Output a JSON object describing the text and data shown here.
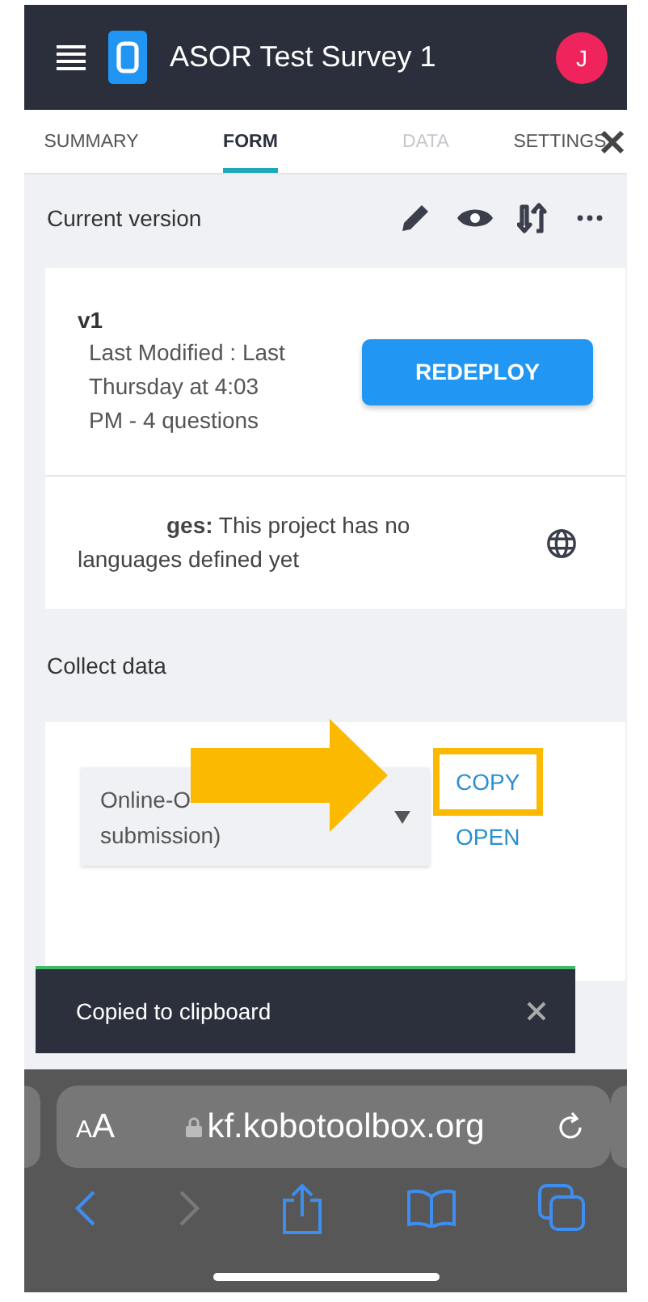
{
  "header": {
    "title": "ASOR Test Survey 1",
    "avatar": "J"
  },
  "tabs": [
    {
      "label": "SUMMARY",
      "selected": false,
      "disabled": false
    },
    {
      "label": "FORM",
      "selected": true,
      "disabled": false
    },
    {
      "label": "DATA",
      "selected": false,
      "disabled": true
    },
    {
      "label": "SETTINGS",
      "selected": false,
      "disabled": false
    }
  ],
  "version_bar": {
    "label": "Current version"
  },
  "version_card": {
    "version": "v1",
    "details": "Last Modified : Last Thursday at 4:03 PM - 4 questions",
    "button": "REDEPLOY"
  },
  "languages_card": {
    "text": "**ges:** This project has no languages defined yet"
  },
  "collect": {
    "heading": "Collect data",
    "select_lines": [
      "Online-O",
      "submission)"
    ],
    "links": [
      {
        "label": "COPY",
        "highlighted": true
      },
      {
        "label": "OPEN",
        "highlighted": false
      }
    ]
  },
  "toast": {
    "message": "Copied to clipboard"
  },
  "browser": {
    "aa": "AA",
    "url": "kf.kobotoolbox.org",
    "back_disabled": false,
    "forward_disabled": true
  }
}
